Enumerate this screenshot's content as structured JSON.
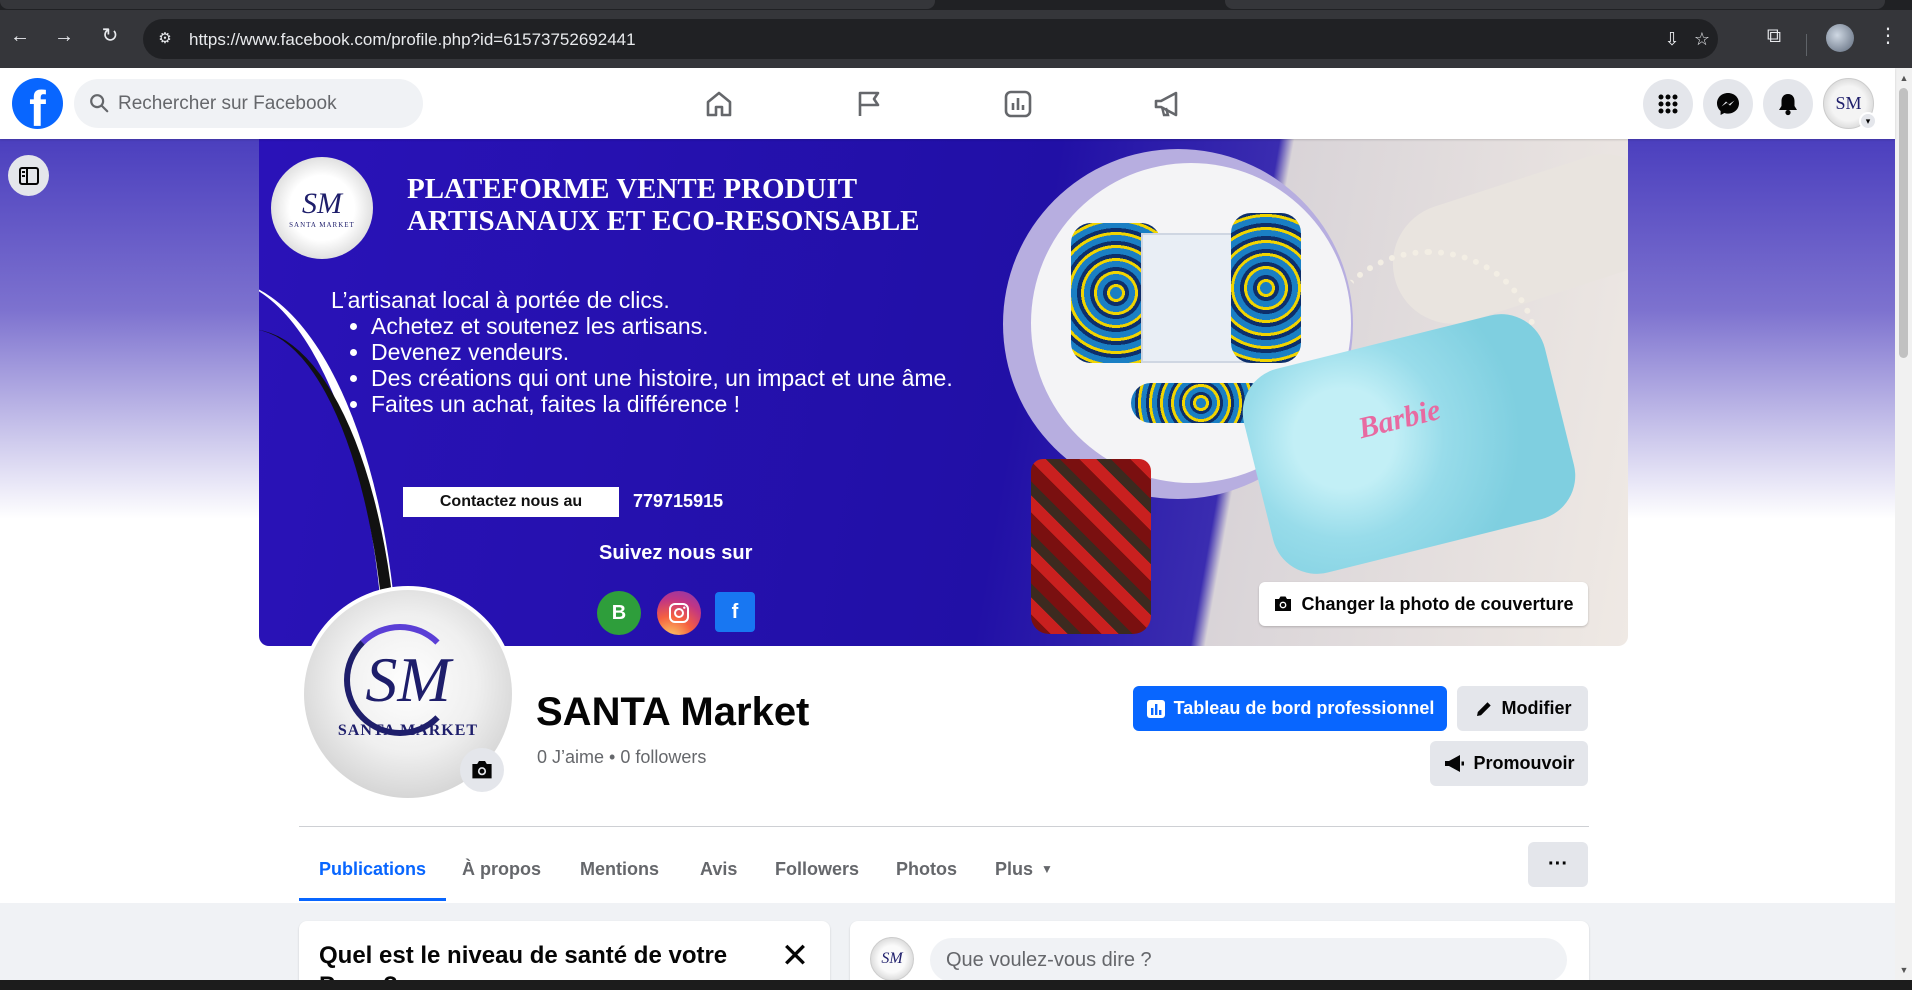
{
  "browser": {
    "url": "https://www.facebook.com/profile.php?id=61573752692441",
    "icons": [
      "back-icon",
      "forward-icon",
      "reload-icon",
      "site-settings-icon",
      "install-app-icon",
      "bookmark-star-icon",
      "extensions-icon",
      "profile-avatar",
      "menu-kebab-icon"
    ]
  },
  "fb": {
    "logo": "f",
    "search_placeholder": "Rechercher sur Facebook",
    "nav_icons": [
      "home-icon",
      "flag-pages-icon",
      "insights-icon",
      "megaphone-icon"
    ],
    "right_icons": [
      "menu-grid-icon",
      "messenger-icon",
      "notifications-bell-icon"
    ],
    "avatar_text": "SM",
    "brand_color": "#0866ff"
  },
  "cover": {
    "headline_1": "PLATEFORME VENTE PRODUIT",
    "headline_2": "ARTISANAUX ET ECO-RESONSABLE",
    "tagline": "L’artisanat local à portée de clics.",
    "bullets": [
      "Achetez et soutenez les artisans.",
      "Devenez vendeurs.",
      "Des créations qui ont une histoire, un impact et une âme.",
      "Faites un achat, faites la différence !"
    ],
    "contact_label": "Contactez nous  au",
    "phone": "779715915",
    "follow_label": "Suivez nous sur",
    "logo_initials": "SM",
    "logo_name": "SANTA  MARKET",
    "bag_brand": "Barbie",
    "social_letters": [
      "B",
      "",
      "f"
    ],
    "change_cover_label": "Changer la photo de couverture"
  },
  "profile": {
    "avatar_initials": "SM",
    "avatar_name": "SANTA  MARKET",
    "name": "SANTA Market",
    "stats": "0 J’aime • 0 followers",
    "dashboard_button": "Tableau de bord professionnel",
    "edit_button": "Modifier",
    "promote_button": "Promouvoir"
  },
  "tabs": [
    {
      "label": "Publications",
      "active": true
    },
    {
      "label": "À propos"
    },
    {
      "label": "Mentions"
    },
    {
      "label": "Avis"
    },
    {
      "label": "Followers"
    },
    {
      "label": "Photos"
    },
    {
      "label": "Plus"
    }
  ],
  "more_label": "···",
  "health_card": {
    "title": "Quel est le niveau de santé de votre Page ?",
    "close": "✕"
  },
  "composer": {
    "avatar_initials": "SM",
    "placeholder": "Que voulez-vous dire ?"
  }
}
